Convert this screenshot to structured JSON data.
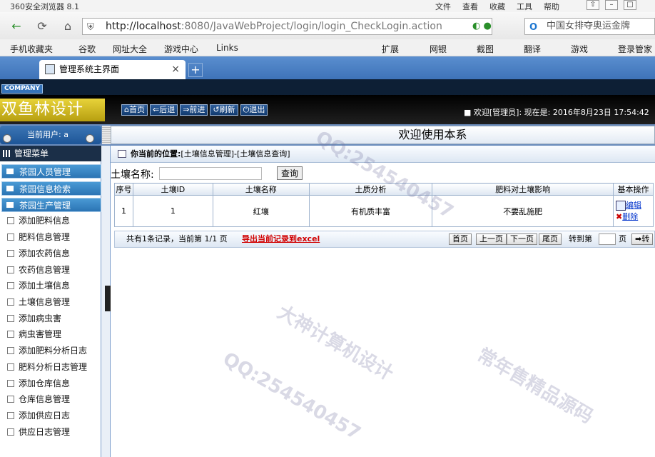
{
  "browser": {
    "app_name": "360安全浏览器 8.1",
    "menu": [
      "文件",
      "查看",
      "收藏",
      "工具",
      "帮助"
    ],
    "url_host": "http://localhost",
    "url_rest": ":8080/JavaWebProject/login/login_CheckLogin.action",
    "search_text": "中国女排夺奥运金牌",
    "favorites": [
      "手机收藏夹",
      "谷歌",
      "网址大全",
      "游戏中心",
      "Links",
      "扩展",
      "网银",
      "截图",
      "翻译",
      "游戏",
      "登录管家"
    ],
    "tab_title": "管理系统主界面"
  },
  "app": {
    "company": "COMPANY",
    "logo_text": "双鱼林设计",
    "toolbar": [
      "首页",
      "后退",
      "前进",
      "刷新",
      "退出"
    ],
    "welcome": "■ 欢迎[管理员]: 现在是: 2016年8月23日 17:54:42",
    "current_user": "当前用户: a",
    "welcome_banner": "欢迎使用本系",
    "menu_title": "管理菜单",
    "sections": [
      "茶园人员管理",
      "茶园信息检索",
      "茶园生产管理"
    ],
    "menu_items": [
      "添加肥料信息",
      "肥料信息管理",
      "添加农药信息",
      "农药信息管理",
      "添加土壤信息",
      "土壤信息管理",
      "添加病虫害",
      "病虫害管理",
      "添加肥料分析日志",
      "肥料分析日志管理",
      "添加仓库信息",
      "仓库信息管理",
      "添加供应日志",
      "供应日志管理"
    ]
  },
  "main": {
    "location_prefix": "你当前的位置:",
    "location_path": "[土壤信息管理]-[土壤信息查询]",
    "search_label": "土壤名称:",
    "search_value": "",
    "search_button": "查询",
    "columns": [
      "序号",
      "土壤ID",
      "土壤名称",
      "土质分析",
      "肥料对土壤影响",
      "基本操作"
    ],
    "rows": [
      {
        "no": "1",
        "id": "1",
        "name": "红壤",
        "analysis": "有机质丰富",
        "effect": "不要乱施肥",
        "edit": "编辑",
        "delete": "删除"
      }
    ],
    "pager": {
      "info": "共有1条记录，当前第 1/1 页",
      "export": "导出当前记录到excel",
      "first": "首页",
      "prev": "上一页",
      "next": "下一页",
      "last": "尾页",
      "goto_label": "转到第",
      "page_unit": "页",
      "goto_button": "转"
    }
  },
  "watermark": [
    "QQ:254540457",
    "大神计算机设计",
    "常年售精品源码"
  ]
}
